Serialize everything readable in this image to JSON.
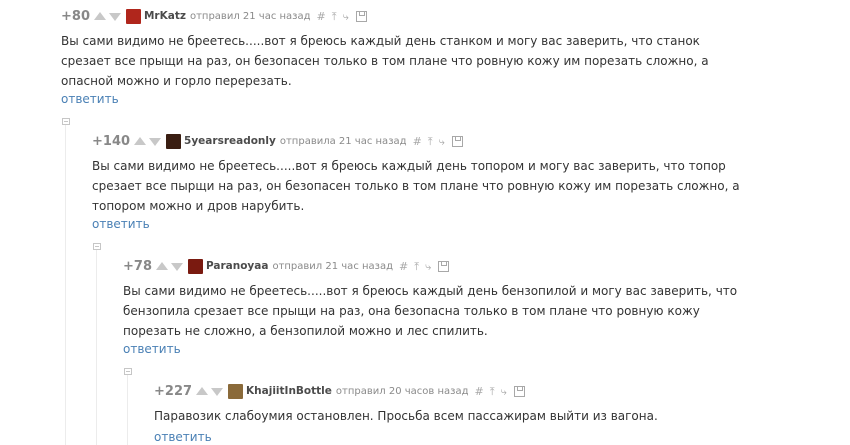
{
  "comments": [
    {
      "rating": "+80",
      "author": "MrKatz",
      "meta": "отправил 21 час назад",
      "avatar_color": "#b0261c",
      "text": "Вы сами видимо не бреетесь.....вот я бреюсь каждый день станком и могу вас заверить, что станок срезает все прыщи на раз, он безопасен только в том плане что ровную кожу им порезать сложно, а опасной можно и горло перерезать.",
      "reply_label": "ответить"
    },
    {
      "rating": "+140",
      "author": "5yearsreadonly",
      "meta": "отправила 21 час назад",
      "avatar_color": "#3a1e12",
      "text": "Вы сами видимо не бреетесь.....вот я бреюсь каждый день топором и могу вас заверить, что топор срезает все пырщи на раз, он безопасен только в том плане что ровную кожу им порезать сложно, а топором можно и дров нарубить.",
      "reply_label": "ответить"
    },
    {
      "rating": "+78",
      "author": "Paranoyaa",
      "meta": "отправил 21 час назад",
      "avatar_color": "#7a1a10",
      "text": "Вы сами видимо не бреетесь.....вот я бреюсь каждый день бензопилой и могу вас заверить, что бензопила срезает все прыщи на раз, она безопасна только в том плане что ровную кожу порезать не сложно, а бензопилой можно и лес спилить.",
      "reply_label": "ответить"
    },
    {
      "rating": "+227",
      "author": "KhajiitInBottle",
      "meta": "отправил 20 часов назад",
      "avatar_color": "#8a6a3a",
      "text": "Паравозик слабоумия остановлен. Просьба всем пассажирам выйти из вагона.",
      "reply_label": "ответить"
    }
  ],
  "tools": {
    "hash": "#",
    "up": "⤒",
    "branch": "⤷"
  }
}
